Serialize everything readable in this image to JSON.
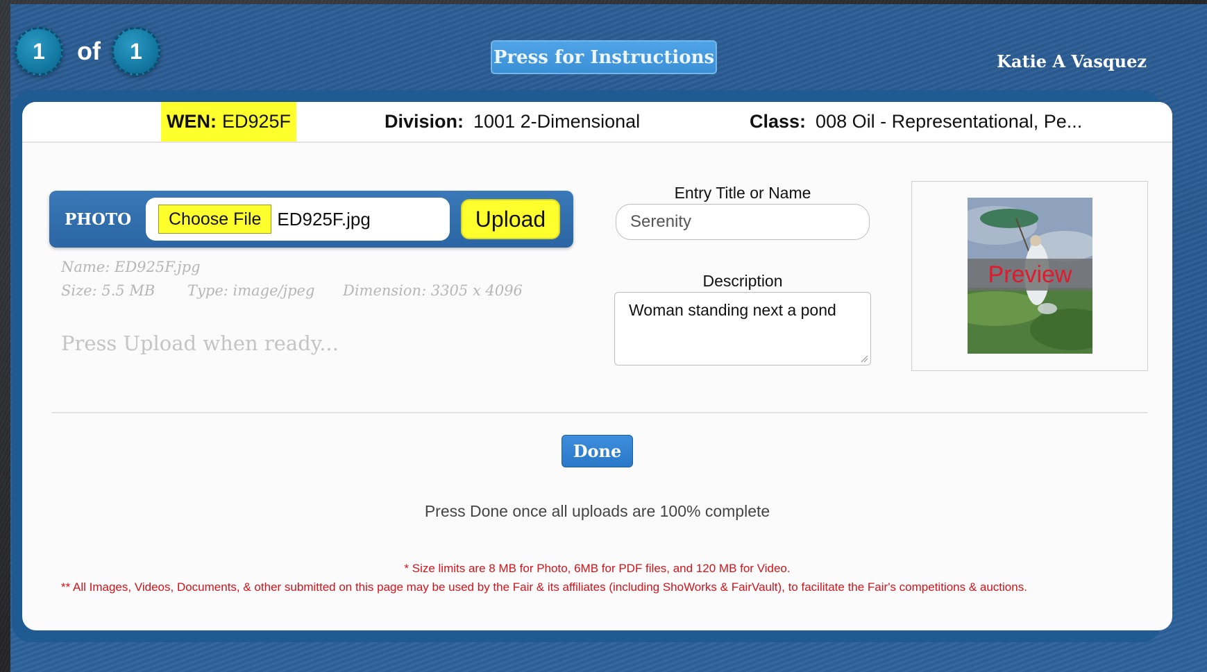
{
  "header": {
    "current_page": "1",
    "of_label": "of",
    "total_pages": "1",
    "instructions_button": "Press for Instructions",
    "user_name": "Katie A Vasquez"
  },
  "entry_info": {
    "wen_label": "WEN:",
    "wen_value": "ED925F",
    "division_label": "Division:",
    "division_value": "1001 2-Dimensional",
    "class_label": "Class:",
    "class_value": "008 Oil - Representational, Pe..."
  },
  "photo_upload": {
    "label": "PHOTO",
    "choose_button": "Choose File",
    "file_name": "ED925F.jpg",
    "upload_button": "Upload",
    "meta_name": "Name: ED925F.jpg",
    "meta_size": "Size: 5.5 MB",
    "meta_type": "Type: image/jpeg",
    "meta_dimension": "Dimension: 3305 x 4096",
    "status_message": "Press Upload when ready..."
  },
  "form": {
    "title_label": "Entry Title or Name",
    "title_value": "Serenity",
    "description_label": "Description",
    "description_value": "Woman standing next a pond"
  },
  "preview": {
    "banner_text": "Preview"
  },
  "footer": {
    "done_button": "Done",
    "done_message": "Press Done once all uploads are 100% complete",
    "note_size_limits": "* Size limits are 8 MB for Photo, 6MB for PDF files, and 120 MB for Video.",
    "note_usage": "** All Images, Videos, Documents, & other submitted on this page may be used by the Fair & its affiliates (including ShoWorks & FairVault), to facilitate the Fair's competitions & auctions."
  },
  "colors": {
    "highlight": "#ffff2e",
    "brand_blue": "#2a5a92",
    "button_blue": "#3a8fd6",
    "note_red": "#d2131b"
  }
}
